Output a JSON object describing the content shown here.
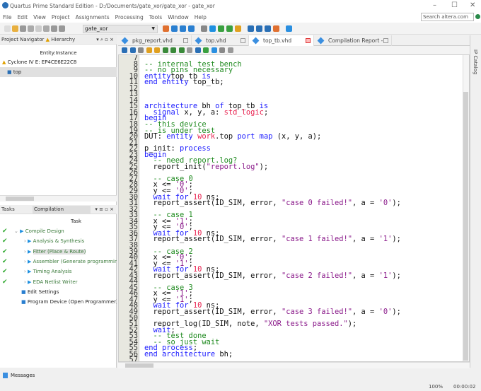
{
  "window": {
    "title": "Quartus Prime Standard Edition - D:/Documents/gate_xor/gate_xor - gate_xor",
    "search_placeholder": "Search altera.com"
  },
  "menu": [
    "File",
    "Edit",
    "View",
    "Project",
    "Assignments",
    "Processing",
    "Tools",
    "Window",
    "Help"
  ],
  "toolbar": {
    "project": "gate_xor"
  },
  "navigator": {
    "title": "Project Navigator",
    "view": "Hierarchy",
    "column": "Entity:Instance",
    "device": "Cyclone IV E: EP4CE6E22C8",
    "top": "top"
  },
  "tasks": {
    "title": "Tasks",
    "flow": "Compilation",
    "column": "Task",
    "items": [
      {
        "label": "Compile Design",
        "done": true
      },
      {
        "label": "Analysis & Synthesis",
        "done": true
      },
      {
        "label": "Fitter (Place & Route)",
        "done": true
      },
      {
        "label": "Assembler (Generate programming files)",
        "done": true
      },
      {
        "label": "Timing Analysis",
        "done": true
      },
      {
        "label": "EDA Netlist Writer",
        "done": true
      },
      {
        "label": "Edit Settings",
        "done": false
      },
      {
        "label": "Program Device (Open Programmer)",
        "done": false
      }
    ]
  },
  "tabs": [
    {
      "label": "pkg_report.vhd"
    },
    {
      "label": "top.vhd"
    },
    {
      "label": "top_tb.vhd",
      "active": true
    },
    {
      "label": "Compilation Report - gate_xor"
    }
  ],
  "ip_catalog": "IP Catalog",
  "code": {
    "first_line": 7,
    "lines": [
      [],
      [
        [
          "c",
          "-- internal test bench"
        ]
      ],
      [
        [
          "c",
          "-- no pins necessary"
        ]
      ],
      [
        [
          "k",
          "entity"
        ],
        [
          "",
          "top_tb "
        ],
        [
          "k",
          "is"
        ]
      ],
      [
        [
          "k",
          "end entity"
        ],
        [
          "",
          " top_tb;"
        ]
      ],
      [],
      [],
      [],
      [
        [
          "k",
          "architecture"
        ],
        [
          "",
          " bh "
        ],
        [
          "k",
          "of"
        ],
        [
          "",
          " top_tb "
        ],
        [
          "k",
          "is"
        ]
      ],
      [
        [
          "",
          "  "
        ],
        [
          "k",
          "signal"
        ],
        [
          "",
          " x, y, a: "
        ],
        [
          "t",
          "std_logic"
        ],
        [
          "",
          ";"
        ]
      ],
      [
        [
          "k",
          "begin"
        ]
      ],
      [
        [
          "c",
          "-- this device"
        ]
      ],
      [
        [
          "c",
          "-- is under test"
        ]
      ],
      [
        [
          "",
          "DUT: "
        ],
        [
          "k",
          "entity"
        ],
        [
          "",
          " "
        ],
        [
          "t",
          "work"
        ],
        [
          "",
          ".top "
        ],
        [
          "k",
          "port map"
        ],
        [
          "",
          " (x, y, a);"
        ]
      ],
      [],
      [
        [
          "",
          "p_init: "
        ],
        [
          "k",
          "process"
        ]
      ],
      [
        [
          "k",
          "begin"
        ]
      ],
      [
        [
          "",
          "  "
        ],
        [
          "c",
          "-- need report.log?"
        ]
      ],
      [
        [
          "",
          "  report_init("
        ],
        [
          "s",
          "\"report.log\""
        ],
        [
          "",
          ");"
        ]
      ],
      [],
      [
        [
          "",
          "  "
        ],
        [
          "c",
          "-- case 0"
        ]
      ],
      [
        [
          "",
          "  x <= "
        ],
        [
          "s",
          "'0'"
        ],
        [
          "",
          ";"
        ]
      ],
      [
        [
          "",
          "  y <= "
        ],
        [
          "s",
          "'0'"
        ],
        [
          "",
          ";"
        ]
      ],
      [
        [
          "",
          "  "
        ],
        [
          "k",
          "wait for"
        ],
        [
          "",
          " "
        ],
        [
          "n",
          "10"
        ],
        [
          "",
          " ns;"
        ]
      ],
      [
        [
          "",
          "  report_assert(ID_SIM, error, "
        ],
        [
          "s",
          "\"case 0 failed!\""
        ],
        [
          "",
          ", a = "
        ],
        [
          "s",
          "'0'"
        ],
        [
          "",
          ");"
        ]
      ],
      [],
      [
        [
          "",
          "  "
        ],
        [
          "c",
          "-- case 1"
        ]
      ],
      [
        [
          "",
          "  x <= "
        ],
        [
          "s",
          "'1'"
        ],
        [
          "",
          ";"
        ]
      ],
      [
        [
          "",
          "  y <= "
        ],
        [
          "s",
          "'0'"
        ],
        [
          "",
          ";"
        ]
      ],
      [
        [
          "",
          "  "
        ],
        [
          "k",
          "wait for"
        ],
        [
          "",
          " "
        ],
        [
          "n",
          "10"
        ],
        [
          "",
          " ns;"
        ]
      ],
      [
        [
          "",
          "  report_assert(ID_SIM, error, "
        ],
        [
          "s",
          "\"case 1 failed!\""
        ],
        [
          "",
          ", a = "
        ],
        [
          "s",
          "'1'"
        ],
        [
          "",
          ");"
        ]
      ],
      [],
      [
        [
          "",
          "  "
        ],
        [
          "c",
          "-- case 2"
        ]
      ],
      [
        [
          "",
          "  x <= "
        ],
        [
          "s",
          "'0'"
        ],
        [
          "",
          ";"
        ]
      ],
      [
        [
          "",
          "  y <= "
        ],
        [
          "s",
          "'1'"
        ],
        [
          "",
          ";"
        ]
      ],
      [
        [
          "",
          "  "
        ],
        [
          "k",
          "wait for"
        ],
        [
          "",
          " "
        ],
        [
          "n",
          "10"
        ],
        [
          "",
          " ns;"
        ]
      ],
      [
        [
          "",
          "  report_assert(ID_SIM, error, "
        ],
        [
          "s",
          "\"case 2 failed!\""
        ],
        [
          "",
          ", a = "
        ],
        [
          "s",
          "'1'"
        ],
        [
          "",
          ");"
        ]
      ],
      [],
      [
        [
          "",
          "  "
        ],
        [
          "c",
          "-- case 3"
        ]
      ],
      [
        [
          "",
          "  x <= "
        ],
        [
          "s",
          "'1'"
        ],
        [
          "",
          ";"
        ]
      ],
      [
        [
          "",
          "  y <= "
        ],
        [
          "s",
          "'1'"
        ],
        [
          "",
          ";"
        ]
      ],
      [
        [
          "",
          "  "
        ],
        [
          "k",
          "wait for"
        ],
        [
          "",
          " "
        ],
        [
          "n",
          "10"
        ],
        [
          "",
          " ns;"
        ]
      ],
      [
        [
          "",
          "  report_assert(ID_SIM, error, "
        ],
        [
          "s",
          "\"case 3 failed!\""
        ],
        [
          "",
          ", a = "
        ],
        [
          "s",
          "'0'"
        ],
        [
          "",
          ");"
        ]
      ],
      [],
      [
        [
          "",
          "  report_log(ID_SIM, note, "
        ],
        [
          "s",
          "\"XOR tests passed.\""
        ],
        [
          "",
          ");"
        ]
      ],
      [
        [
          "",
          "  "
        ],
        [
          "k",
          "wait"
        ],
        [
          "",
          ";"
        ]
      ],
      [
        [
          "",
          "  "
        ],
        [
          "c",
          "-- test done"
        ]
      ],
      [
        [
          "",
          "  "
        ],
        [
          "c",
          "-- so just wait"
        ]
      ],
      [
        [
          "k",
          "end process"
        ],
        [
          "",
          ";"
        ]
      ],
      [
        [
          "k",
          "end architecture"
        ],
        [
          "",
          " bh;"
        ]
      ],
      []
    ]
  },
  "messages": {
    "label": "Messages"
  },
  "status": {
    "zoom": "100%",
    "elapsed": "00:00:02"
  }
}
